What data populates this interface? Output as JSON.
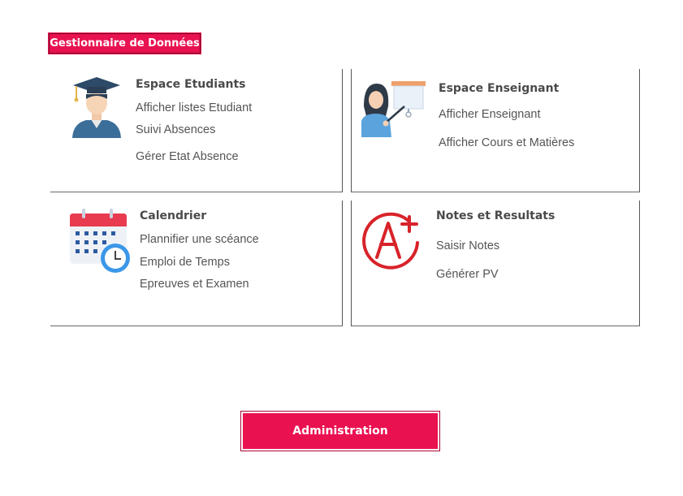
{
  "app": {
    "title": "Gestionnaire de Données"
  },
  "cards": [
    {
      "heading": "Espace Etudiants",
      "links": [
        "Afficher listes Etudiant",
        "Suivi Absences",
        "Gérer Etat Absence"
      ]
    },
    {
      "heading": "Espace Enseignant",
      "links": [
        "Afficher Enseignant",
        "Afficher Cours et Matières"
      ]
    },
    {
      "heading": "Calendrier",
      "links": [
        "Plannifier une scéance",
        "Emploi de Temps",
        "Epreuves et Examen"
      ]
    },
    {
      "heading": "Notes et Resultats",
      "links": [
        "Saisir Notes",
        "Générer PV"
      ]
    }
  ],
  "icons": [
    "graduate-icon",
    "teacher-icon",
    "calendar-icon",
    "grade-a-plus-icon"
  ],
  "admin": {
    "label": "Administration"
  },
  "colors": {
    "accent": "#e91250"
  }
}
